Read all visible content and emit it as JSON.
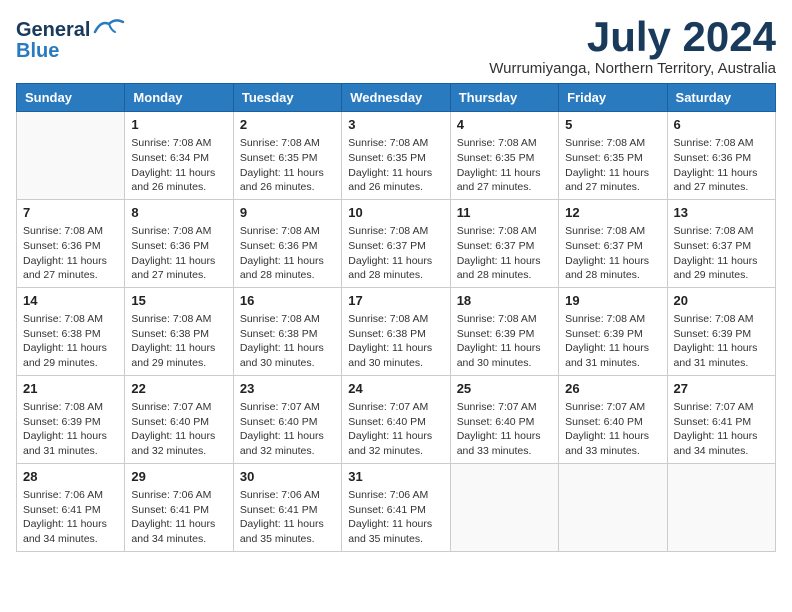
{
  "logo": {
    "general": "General",
    "blue": "Blue"
  },
  "title": {
    "month_year": "July 2024",
    "location": "Wurrumiyanga, Northern Territory, Australia"
  },
  "days_of_week": [
    "Sunday",
    "Monday",
    "Tuesday",
    "Wednesday",
    "Thursday",
    "Friday",
    "Saturday"
  ],
  "weeks": [
    [
      {
        "day": "",
        "detail": ""
      },
      {
        "day": "1",
        "detail": "Sunrise: 7:08 AM\nSunset: 6:34 PM\nDaylight: 11 hours\nand 26 minutes."
      },
      {
        "day": "2",
        "detail": "Sunrise: 7:08 AM\nSunset: 6:35 PM\nDaylight: 11 hours\nand 26 minutes."
      },
      {
        "day": "3",
        "detail": "Sunrise: 7:08 AM\nSunset: 6:35 PM\nDaylight: 11 hours\nand 26 minutes."
      },
      {
        "day": "4",
        "detail": "Sunrise: 7:08 AM\nSunset: 6:35 PM\nDaylight: 11 hours\nand 27 minutes."
      },
      {
        "day": "5",
        "detail": "Sunrise: 7:08 AM\nSunset: 6:35 PM\nDaylight: 11 hours\nand 27 minutes."
      },
      {
        "day": "6",
        "detail": "Sunrise: 7:08 AM\nSunset: 6:36 PM\nDaylight: 11 hours\nand 27 minutes."
      }
    ],
    [
      {
        "day": "7",
        "detail": "Sunrise: 7:08 AM\nSunset: 6:36 PM\nDaylight: 11 hours\nand 27 minutes."
      },
      {
        "day": "8",
        "detail": "Sunrise: 7:08 AM\nSunset: 6:36 PM\nDaylight: 11 hours\nand 27 minutes."
      },
      {
        "day": "9",
        "detail": "Sunrise: 7:08 AM\nSunset: 6:36 PM\nDaylight: 11 hours\nand 28 minutes."
      },
      {
        "day": "10",
        "detail": "Sunrise: 7:08 AM\nSunset: 6:37 PM\nDaylight: 11 hours\nand 28 minutes."
      },
      {
        "day": "11",
        "detail": "Sunrise: 7:08 AM\nSunset: 6:37 PM\nDaylight: 11 hours\nand 28 minutes."
      },
      {
        "day": "12",
        "detail": "Sunrise: 7:08 AM\nSunset: 6:37 PM\nDaylight: 11 hours\nand 28 minutes."
      },
      {
        "day": "13",
        "detail": "Sunrise: 7:08 AM\nSunset: 6:37 PM\nDaylight: 11 hours\nand 29 minutes."
      }
    ],
    [
      {
        "day": "14",
        "detail": "Sunrise: 7:08 AM\nSunset: 6:38 PM\nDaylight: 11 hours\nand 29 minutes."
      },
      {
        "day": "15",
        "detail": "Sunrise: 7:08 AM\nSunset: 6:38 PM\nDaylight: 11 hours\nand 29 minutes."
      },
      {
        "day": "16",
        "detail": "Sunrise: 7:08 AM\nSunset: 6:38 PM\nDaylight: 11 hours\nand 30 minutes."
      },
      {
        "day": "17",
        "detail": "Sunrise: 7:08 AM\nSunset: 6:38 PM\nDaylight: 11 hours\nand 30 minutes."
      },
      {
        "day": "18",
        "detail": "Sunrise: 7:08 AM\nSunset: 6:39 PM\nDaylight: 11 hours\nand 30 minutes."
      },
      {
        "day": "19",
        "detail": "Sunrise: 7:08 AM\nSunset: 6:39 PM\nDaylight: 11 hours\nand 31 minutes."
      },
      {
        "day": "20",
        "detail": "Sunrise: 7:08 AM\nSunset: 6:39 PM\nDaylight: 11 hours\nand 31 minutes."
      }
    ],
    [
      {
        "day": "21",
        "detail": "Sunrise: 7:08 AM\nSunset: 6:39 PM\nDaylight: 11 hours\nand 31 minutes."
      },
      {
        "day": "22",
        "detail": "Sunrise: 7:07 AM\nSunset: 6:40 PM\nDaylight: 11 hours\nand 32 minutes."
      },
      {
        "day": "23",
        "detail": "Sunrise: 7:07 AM\nSunset: 6:40 PM\nDaylight: 11 hours\nand 32 minutes."
      },
      {
        "day": "24",
        "detail": "Sunrise: 7:07 AM\nSunset: 6:40 PM\nDaylight: 11 hours\nand 32 minutes."
      },
      {
        "day": "25",
        "detail": "Sunrise: 7:07 AM\nSunset: 6:40 PM\nDaylight: 11 hours\nand 33 minutes."
      },
      {
        "day": "26",
        "detail": "Sunrise: 7:07 AM\nSunset: 6:40 PM\nDaylight: 11 hours\nand 33 minutes."
      },
      {
        "day": "27",
        "detail": "Sunrise: 7:07 AM\nSunset: 6:41 PM\nDaylight: 11 hours\nand 34 minutes."
      }
    ],
    [
      {
        "day": "28",
        "detail": "Sunrise: 7:06 AM\nSunset: 6:41 PM\nDaylight: 11 hours\nand 34 minutes."
      },
      {
        "day": "29",
        "detail": "Sunrise: 7:06 AM\nSunset: 6:41 PM\nDaylight: 11 hours\nand 34 minutes."
      },
      {
        "day": "30",
        "detail": "Sunrise: 7:06 AM\nSunset: 6:41 PM\nDaylight: 11 hours\nand 35 minutes."
      },
      {
        "day": "31",
        "detail": "Sunrise: 7:06 AM\nSunset: 6:41 PM\nDaylight: 11 hours\nand 35 minutes."
      },
      {
        "day": "",
        "detail": ""
      },
      {
        "day": "",
        "detail": ""
      },
      {
        "day": "",
        "detail": ""
      }
    ]
  ]
}
